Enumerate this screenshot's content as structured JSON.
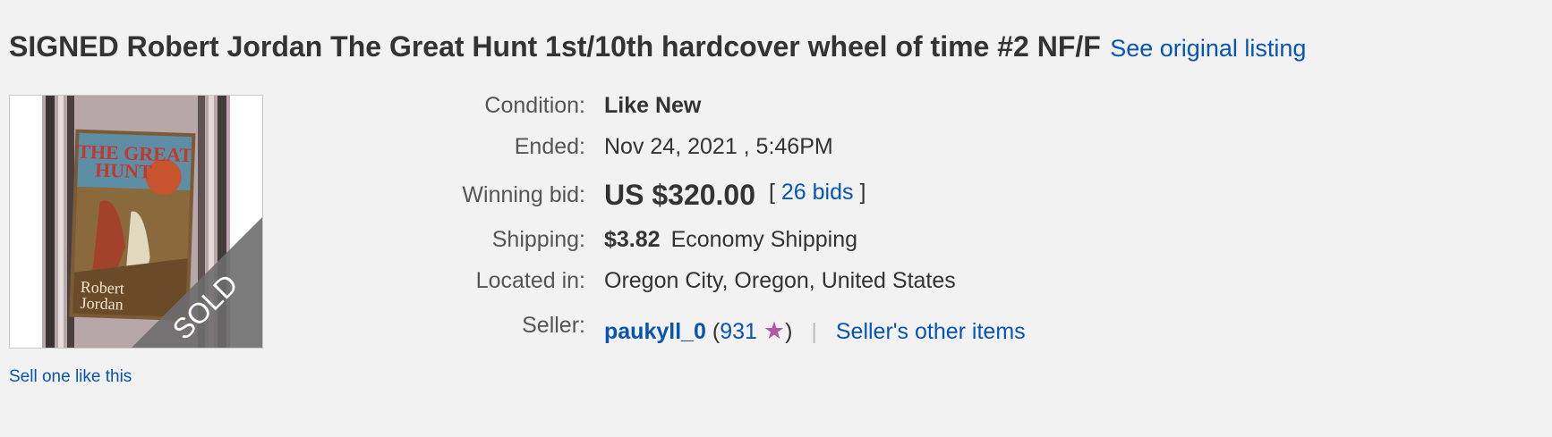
{
  "listing": {
    "title": "SIGNED Robert Jordan The Great Hunt 1st/10th hardcover wheel of time #2 NF/F",
    "see_original": "See original listing",
    "sell_one": "Sell one like this"
  },
  "thumbnail": {
    "book_title_line1": "THE GREAT",
    "book_title_line2": "HUNT",
    "author_line1": "Robert",
    "author_line2": "Jordan",
    "sold_banner": "SOLD"
  },
  "details": {
    "condition": {
      "label": "Condition:",
      "value": "Like New"
    },
    "ended": {
      "label": "Ended:",
      "value": "Nov 24, 2021 , 5:46PM"
    },
    "winning_bid": {
      "label": "Winning bid:",
      "price": "US $320.00",
      "bracket_open": "[",
      "bids": "26 bids",
      "bracket_close": "]"
    },
    "shipping": {
      "label": "Shipping:",
      "price": "$3.82",
      "method": "Economy Shipping"
    },
    "location": {
      "label": "Located in:",
      "value": "Oregon City, Oregon, United States"
    },
    "seller": {
      "label": "Seller:",
      "name": "paukyll_0",
      "paren_open": "(",
      "feedback": "931",
      "star_icon": "purple-star-icon",
      "paren_close": ")",
      "separator": "|",
      "other_items": "Seller's other items"
    }
  },
  "colors": {
    "background": "#f2f2f2",
    "link": "#0654ba",
    "text": "#333333",
    "label": "#555555",
    "star": "#b455a8"
  }
}
